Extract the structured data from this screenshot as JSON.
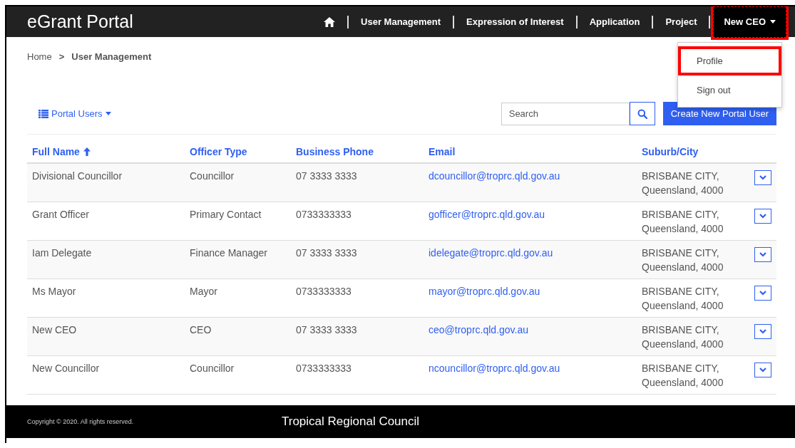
{
  "navbar": {
    "brand": "eGrant Portal",
    "items": [
      {
        "kind": "home",
        "highlighted": false
      },
      {
        "kind": "link",
        "label": "User Management",
        "highlighted": false
      },
      {
        "kind": "link",
        "label": "Expression of Interest",
        "highlighted": false
      },
      {
        "kind": "link",
        "label": "Application",
        "highlighted": false
      },
      {
        "kind": "link",
        "label": "Project",
        "highlighted": false
      },
      {
        "kind": "user",
        "label": "New CEO",
        "highlighted": true
      }
    ]
  },
  "user_menu": {
    "expanded": true,
    "items": [
      {
        "label": "Profile",
        "highlighted": true
      },
      {
        "label": "Sign out",
        "highlighted": false
      }
    ]
  },
  "breadcrumb": {
    "home": "Home",
    "separator": ">",
    "current": "User Management"
  },
  "view_selector": {
    "label": "Portal Users"
  },
  "search": {
    "placeholder": "Search"
  },
  "create_button": "Create New Portal User",
  "table": {
    "columns": [
      {
        "label": "Full Name",
        "sorted": true
      },
      {
        "label": "Officer Type",
        "sorted": false
      },
      {
        "label": "Business Phone",
        "sorted": false
      },
      {
        "label": "Email",
        "sorted": false
      },
      {
        "label": "Suburb/City",
        "sorted": false
      }
    ],
    "rows": [
      {
        "name": "Divisional Councillor",
        "type": "Councillor",
        "phone": "07 3333 3333",
        "email": "dcouncillor@troprc.qld.gov.au",
        "city": "BRISBANE CITY,",
        "region": "Queensland, 4000"
      },
      {
        "name": "Grant Officer",
        "type": "Primary Contact",
        "phone": "0733333333",
        "email": "gofficer@troprc.qld.gov.au",
        "city": "BRISBANE CITY,",
        "region": "Queensland, 4000"
      },
      {
        "name": "Iam Delegate",
        "type": "Finance Manager",
        "phone": "07 3333 3333",
        "email": "idelegate@troprc.qld.gov.au",
        "city": "BRISBANE CITY,",
        "region": "Queensland, 4000"
      },
      {
        "name": "Ms Mayor",
        "type": "Mayor",
        "phone": "0733333333",
        "email": "mayor@troprc.qld.gov.au",
        "city": "BRISBANE CITY,",
        "region": "Queensland, 4000"
      },
      {
        "name": "New CEO",
        "type": "CEO",
        "phone": "07 3333 3333",
        "email": "ceo@troprc.qld.gov.au",
        "city": "BRISBANE CITY,",
        "region": "Queensland, 4000"
      },
      {
        "name": "New Councillor",
        "type": "Councillor",
        "phone": "0733333333",
        "email": "ncouncillor@troprc.qld.gov.au",
        "city": "BRISBANE CITY,",
        "region": "Queensland, 4000"
      }
    ]
  },
  "footer": {
    "copyright": "Copyright © 2020. All rights reserved.",
    "organisation": "Tropical Regional Council"
  }
}
